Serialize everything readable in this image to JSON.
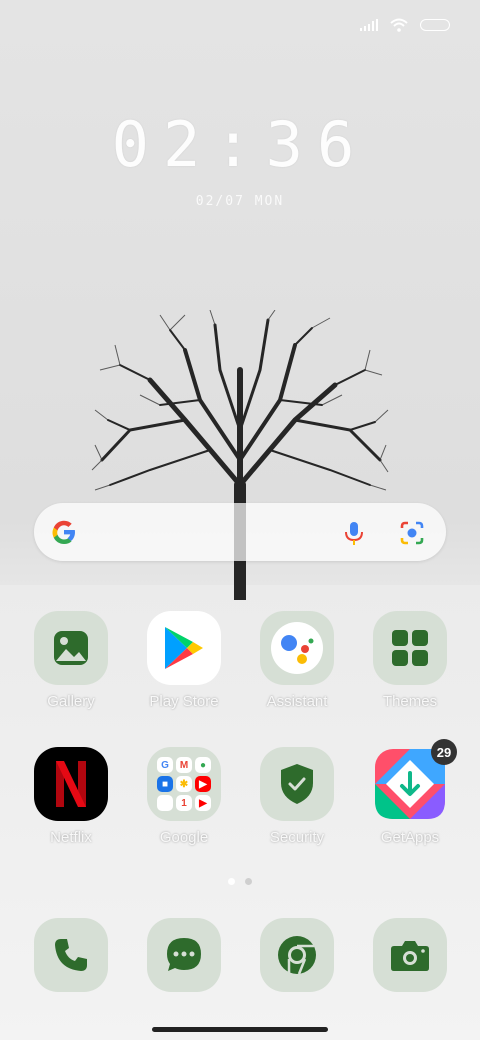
{
  "lockclock": {
    "time": "02:36",
    "date": "02/07 MON"
  },
  "search": {
    "mic_icon": "mic-icon",
    "lens_icon": "lens-icon"
  },
  "apps": [
    {
      "label": "Gallery",
      "icon": "gallery-icon"
    },
    {
      "label": "Play Store",
      "icon": "play-store-icon"
    },
    {
      "label": "Assistant",
      "icon": "assistant-icon"
    },
    {
      "label": "Themes",
      "icon": "themes-icon"
    },
    {
      "label": "Netflix",
      "icon": "netflix-icon"
    },
    {
      "label": "Google",
      "icon": "google-folder-icon"
    },
    {
      "label": "Security",
      "icon": "shield-icon"
    },
    {
      "label": "GetApps",
      "icon": "getapps-icon",
      "badge": "29"
    }
  ],
  "dock": [
    {
      "icon": "phone-icon"
    },
    {
      "icon": "messages-icon"
    },
    {
      "icon": "chrome-icon"
    },
    {
      "icon": "camera-icon"
    }
  ],
  "pages": {
    "count": 2,
    "active": 1
  },
  "colors": {
    "accent_green": "#2e6b2c",
    "icon_bg": "#d6dfd5",
    "netflix_red": "#e50914"
  }
}
